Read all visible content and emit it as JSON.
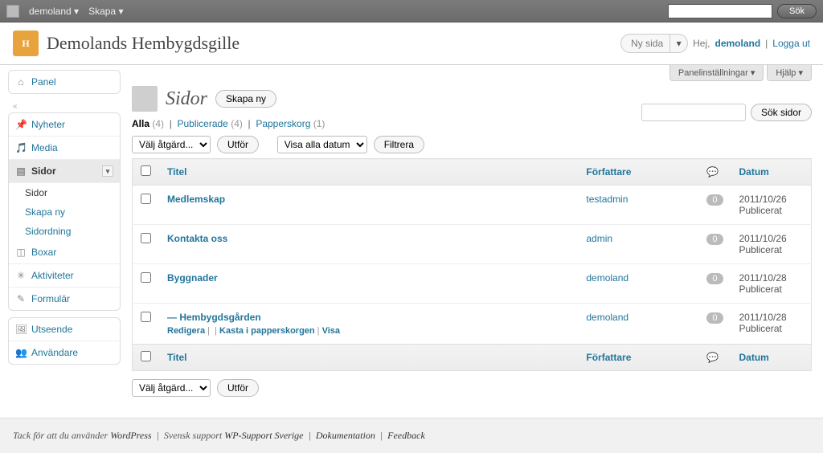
{
  "adminbar": {
    "user_menu": "demoland",
    "skapa": "Skapa",
    "search_placeholder": "",
    "sok": "Sök"
  },
  "header": {
    "site_title": "Demolands Hembygdsgille",
    "ny_sida": "Ny sida",
    "greeting": "Hej,",
    "username": "demoland",
    "logout": "Logga ut"
  },
  "screen": {
    "panel_settings": "Panelinställningar",
    "help": "Hjälp"
  },
  "menu": {
    "panel": "Panel",
    "nyheter": "Nyheter",
    "media": "Media",
    "sidor": "Sidor",
    "sidor_sub_1": "Sidor",
    "sidor_sub_2": "Skapa ny",
    "sidor_sub_3": "Sidordning",
    "boxar": "Boxar",
    "aktiviteter": "Aktiviteter",
    "formular": "Formulär",
    "utseende": "Utseende",
    "anvandare": "Användare"
  },
  "page": {
    "title": "Sidor",
    "skapa_ny": "Skapa ny"
  },
  "filters": {
    "alla": "Alla",
    "alla_count": "(4)",
    "publicerade": "Publicerade",
    "publicerade_count": "(4)",
    "papperskorg": "Papperskorg",
    "papperskorg_count": "(1)"
  },
  "tablenav": {
    "bulk": "Välj åtgärd...",
    "apply": "Utför",
    "date_filter": "Visa alla datum",
    "filtrera": "Filtrera"
  },
  "search": {
    "button": "Sök sidor"
  },
  "columns": {
    "title": "Titel",
    "author": "Författare",
    "date": "Datum"
  },
  "rows": [
    {
      "title": "Medlemskap",
      "author": "testadmin",
      "comments": "0",
      "date": "2011/10/26",
      "status": "Publicerat"
    },
    {
      "title": "Kontakta oss",
      "author": "admin",
      "comments": "0",
      "date": "2011/10/26",
      "status": "Publicerat"
    },
    {
      "title": "Byggnader",
      "author": "demoland",
      "comments": "0",
      "date": "2011/10/28",
      "status": "Publicerat"
    },
    {
      "title": "— Hembygdsgården",
      "author": "demoland",
      "comments": "0",
      "date": "2011/10/28",
      "status": "Publicerat"
    }
  ],
  "row_actions": {
    "redigera": "Redigera",
    "trash": "Kasta i papperskorgen",
    "visa": "Visa"
  },
  "footer": {
    "thanks": "Tack för att du använder",
    "wp": "WordPress",
    "svensk": "Svensk support",
    "wps": "WP-Support Sverige",
    "dok": "Dokumentation",
    "feedback": "Feedback"
  }
}
